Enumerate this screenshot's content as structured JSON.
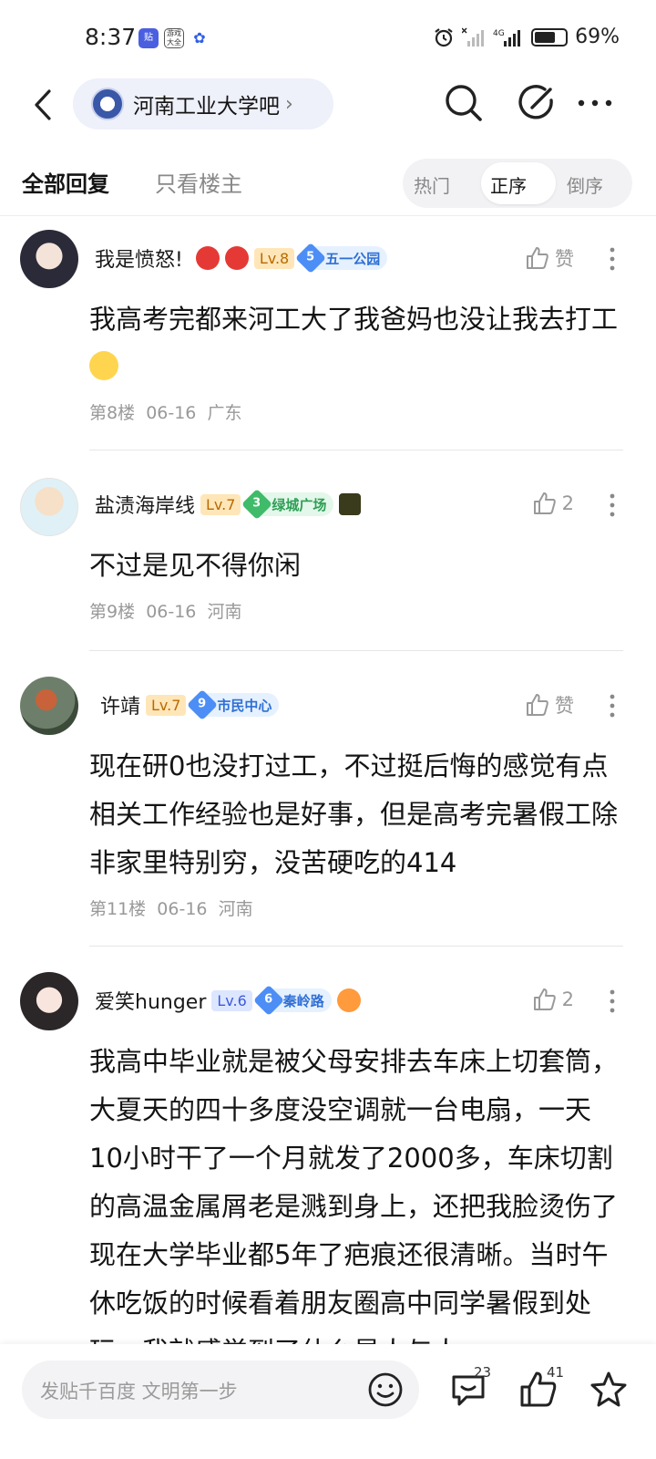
{
  "status_bar": {
    "time": "8:37",
    "app_icons": [
      "贴",
      "游戏大全",
      "百度"
    ],
    "network": "4G",
    "battery_percent": "69%",
    "battery_level": 0.69
  },
  "header": {
    "back_icon": "chevron-left-icon",
    "forum_name": "河南工业大学吧",
    "forum_chevron": "›",
    "icons": [
      "search-icon",
      "edit-icon",
      "more-icon"
    ]
  },
  "tabs": {
    "all_replies": "全部回复",
    "op_only": "只看楼主",
    "sort_options": [
      "热门",
      "正序",
      "倒序"
    ],
    "active_sort": "正序"
  },
  "posts": [
    {
      "username": "我是愤怒!",
      "emojis": [
        "angry",
        "angry"
      ],
      "level": "Lv.8",
      "badge_num": "5",
      "badge_text": "五一公园",
      "likes": "赞",
      "content": "我高考完都来河工大了我爸妈也没让我去打工",
      "floor": "第8楼",
      "date": "06-16",
      "region": "广东"
    },
    {
      "username": "盐渍海岸线",
      "level": "Lv.7",
      "badge_num": "3",
      "badge_text": "绿城广场",
      "likes": "2",
      "content": "不过是见不得你闲",
      "floor": "第9楼",
      "date": "06-16",
      "region": "河南"
    },
    {
      "username": "许靖",
      "level": "Lv.7",
      "badge_num": "9",
      "badge_text": "市民中心",
      "likes": "赞",
      "content": "现在研0也没打过工，不过挺后悔的感觉有点相关工作经验也是好事，但是高考完暑假工除非家里特别穷，没苦硬吃的414",
      "floor": "第11楼",
      "date": "06-16",
      "region": "河南"
    },
    {
      "username": "爱笑hunger",
      "level": "Lv.6",
      "badge_num": "6",
      "badge_text": "秦岭路",
      "likes": "2",
      "content": "我高中毕业就是被父母安排去车床上切套筒，大夏天的四十多度没空调就一台电扇，一天10小时干了一个月就发了2000多，车床切割的高温金属屑老是溅到身上，还把我脸烫伤了现在大学毕业都5年了疤痕还很清晰。当时午休吃饭的时候看着朋友圈高中同学暑假到处玩，我就感觉到了什么是人与人"
    }
  ],
  "bottom_bar": {
    "input_placeholder": "发贴千百度 文明第一步",
    "comment_count": "23",
    "like_count": "41",
    "icons": [
      "emoji-icon",
      "comment-icon",
      "thumbs-up-icon",
      "star-icon"
    ]
  }
}
